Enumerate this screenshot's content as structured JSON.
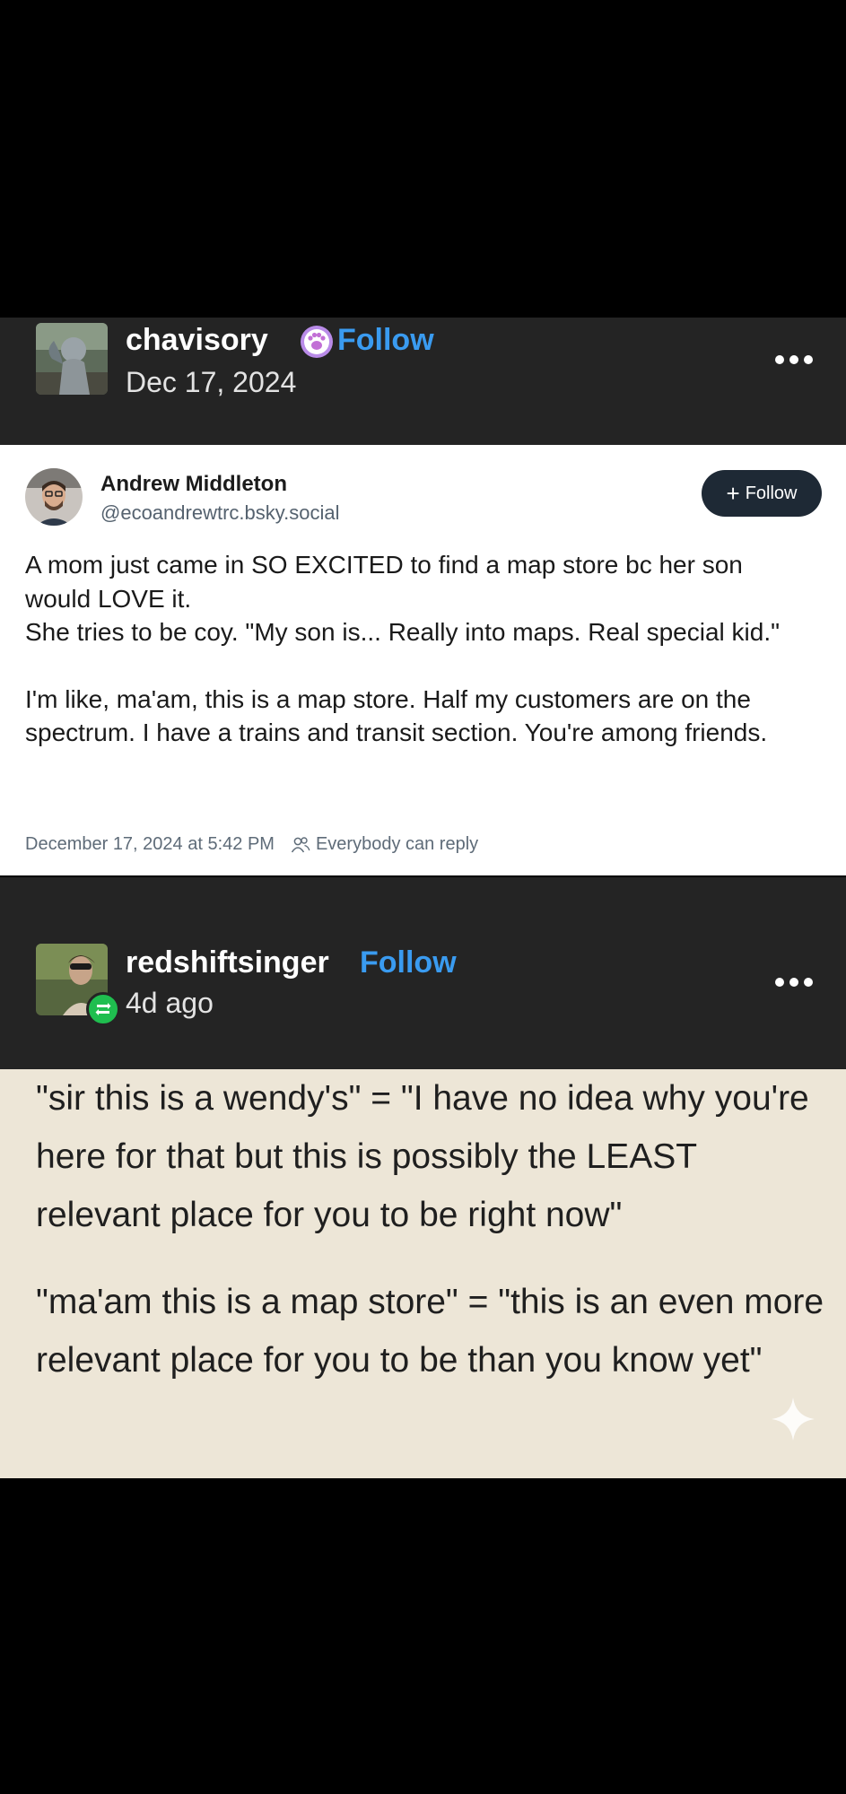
{
  "post1": {
    "username": "chavisory",
    "follow_label": "Follow",
    "date": "Dec 17, 2024",
    "badge_icon": "paw-badge-icon",
    "more_icon": "more-options-icon"
  },
  "embed": {
    "name": "Andrew Middleton",
    "handle": "@ecoandrewtrc.bsky.social",
    "follow_label": "Follow",
    "follow_prefix": "+",
    "paragraph1_line1": "A mom just came in SO EXCITED to find a map store bc her son would LOVE it.",
    "paragraph1_line2": "She tries to be coy. \"My son is... Really into maps. Real special kid.\"",
    "paragraph2": "I'm like, ma'am, this is a map store. Half my customers are on the spectrum. I have a trains and transit section. You're among friends.",
    "timestamp": "December 17, 2024 at 5:42 PM",
    "reply_setting": "Everybody can reply",
    "people_icon": "people-icon"
  },
  "post2": {
    "username": "redshiftsinger",
    "follow_label": "Follow",
    "time_ago": "4d ago",
    "reblog_icon": "reblog-badge-icon",
    "more_icon": "more-options-icon",
    "paragraph1": "\"sir this is a wendy's\" = \"I have no idea why you're here for that but this is possibly the LEAST relevant place for you to be right now\"",
    "paragraph2": "\"ma'am this is a map store\" = \"this is an even more relevant place for you to be than you know yet\""
  },
  "colors": {
    "header_bg": "#242424",
    "tumblr_blue": "#3a9bf0",
    "reply_bg": "#ede6d7",
    "bluesky_follow_bg": "#1e2935",
    "reblog_green": "#1fbe4f",
    "badge_purple": "#b98be8"
  }
}
